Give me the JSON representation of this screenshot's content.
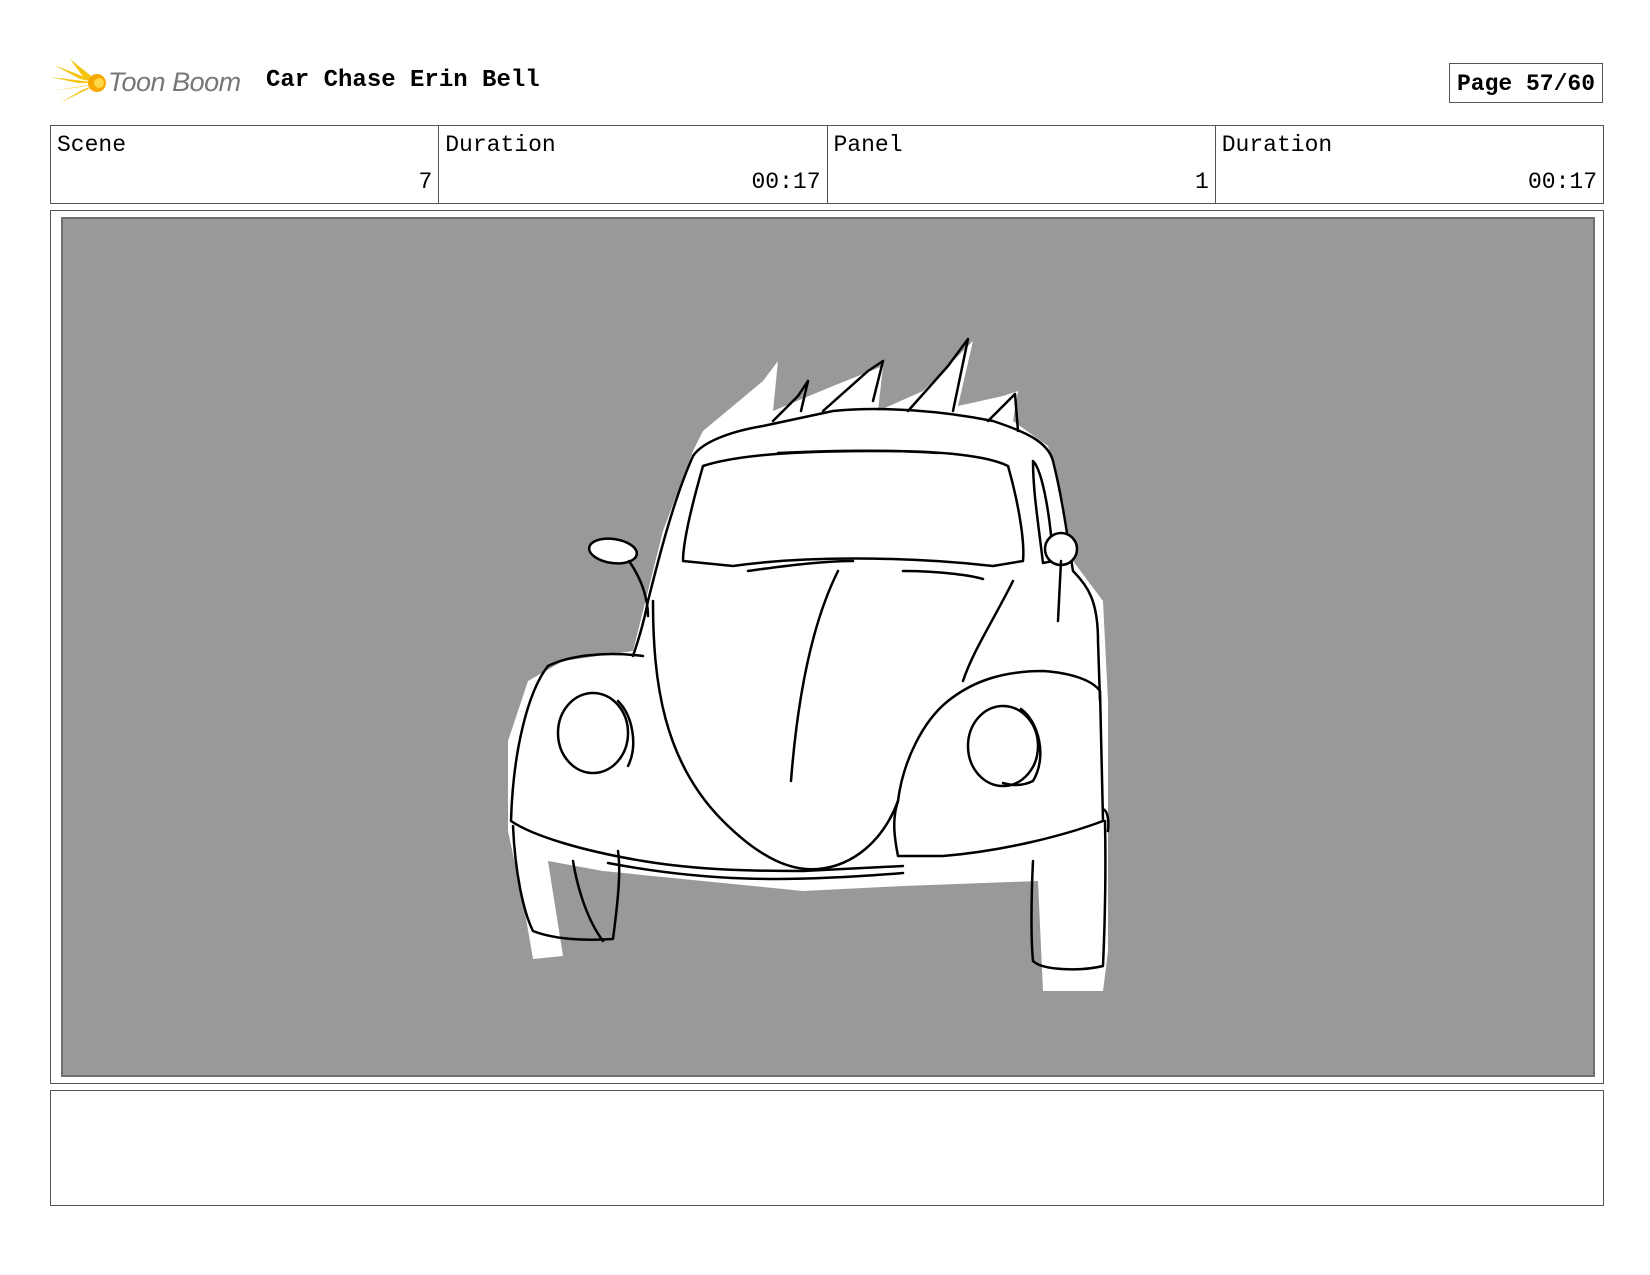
{
  "header": {
    "logo_text": "Toon Boom",
    "title": "Car Chase Erin Bell",
    "page": "Page 57/60"
  },
  "info": {
    "scene_label": "Scene",
    "scene_value": "7",
    "duration_label": "Duration",
    "duration_value": "00:17",
    "panel_label": "Panel",
    "panel_value": "1",
    "panel_duration_label": "Duration",
    "panel_duration_value": "00:17"
  },
  "panel": {
    "background_color": "#999999",
    "drawing": "car-sketch-icon"
  },
  "notes": {
    "text": ""
  }
}
